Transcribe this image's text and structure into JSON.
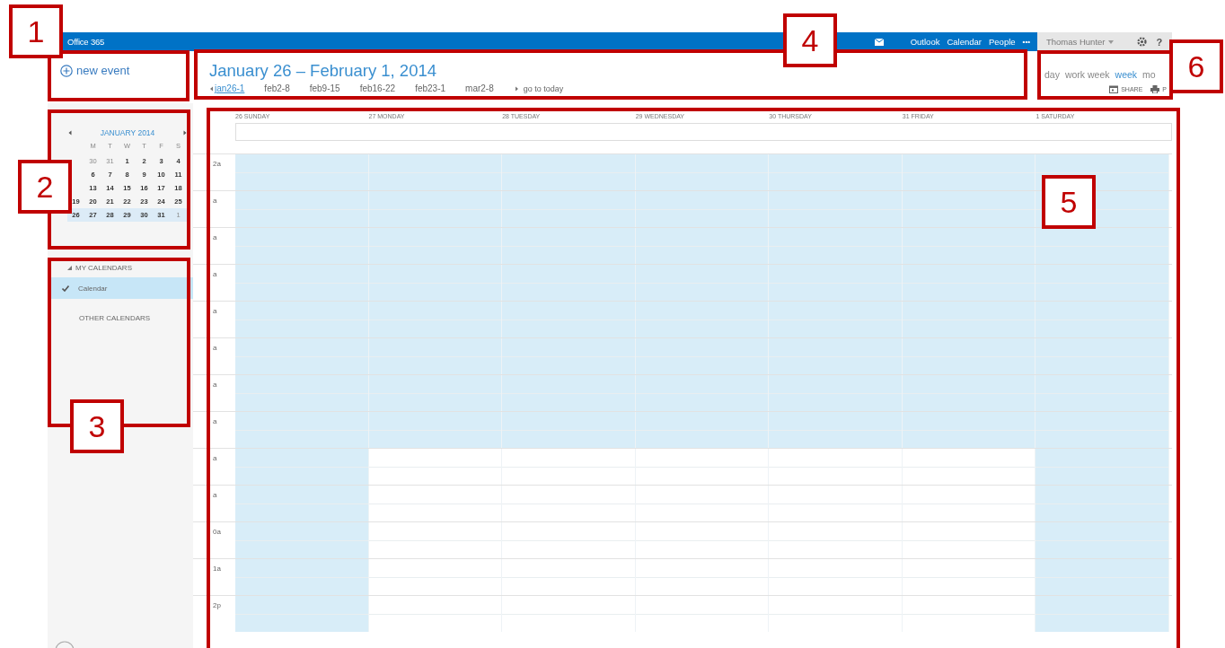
{
  "top_bar": {
    "product": "Office 365",
    "nav": [
      "Outlook",
      "Calendar",
      "People"
    ],
    "more": "•••",
    "user": "Thomas Hunter",
    "help": "?"
  },
  "new_event": {
    "label": "new event"
  },
  "header": {
    "title": "January 26 – February 1, 2014",
    "weeks": [
      {
        "label": "jan26-1",
        "selected": true
      },
      {
        "label": "feb2-8",
        "selected": false
      },
      {
        "label": "feb9-15",
        "selected": false
      },
      {
        "label": "feb16-22",
        "selected": false
      },
      {
        "label": "feb23-1",
        "selected": false
      },
      {
        "label": "mar2-8",
        "selected": false
      }
    ],
    "today": "go to today"
  },
  "views": [
    {
      "label": "day",
      "selected": false
    },
    {
      "label": "work week",
      "selected": false
    },
    {
      "label": "week",
      "selected": true
    },
    {
      "label": "mo",
      "selected": false
    }
  ],
  "actions": [
    {
      "kind": "share",
      "label": "SHARE"
    },
    {
      "kind": "print",
      "label": "P"
    }
  ],
  "mini_calendar": {
    "title": "JANUARY 2014",
    "weekdays": [
      "M",
      "T",
      "W",
      "T",
      "F",
      "S"
    ],
    "weeks": [
      {
        "selected": false,
        "days": [
          {
            "d": "30",
            "other": true
          },
          {
            "d": "31",
            "other": true
          },
          {
            "d": "1",
            "other": false
          },
          {
            "d": "2",
            "other": false
          },
          {
            "d": "3",
            "other": false
          },
          {
            "d": "4",
            "other": false
          }
        ]
      },
      {
        "selected": false,
        "days": [
          {
            "d": "6",
            "other": false
          },
          {
            "d": "7",
            "other": false
          },
          {
            "d": "8",
            "other": false
          },
          {
            "d": "9",
            "other": false
          },
          {
            "d": "10",
            "other": false
          },
          {
            "d": "11",
            "other": false
          }
        ]
      },
      {
        "selected": false,
        "days": [
          {
            "d": "13",
            "other": false
          },
          {
            "d": "14",
            "other": false
          },
          {
            "d": "15",
            "other": false
          },
          {
            "d": "16",
            "other": false
          },
          {
            "d": "17",
            "other": false
          },
          {
            "d": "18",
            "other": false
          }
        ]
      },
      {
        "selected": false,
        "days": [
          {
            "d": "19",
            "other": false
          },
          {
            "d": "20",
            "other": false
          },
          {
            "d": "21",
            "other": false
          },
          {
            "d": "22",
            "other": false
          },
          {
            "d": "23",
            "other": false
          },
          {
            "d": "24",
            "other": false
          },
          {
            "d": "25",
            "other": false
          }
        ]
      },
      {
        "selected": true,
        "days": [
          {
            "d": "26",
            "other": false
          },
          {
            "d": "27",
            "other": false
          },
          {
            "d": "28",
            "other": false
          },
          {
            "d": "29",
            "other": false
          },
          {
            "d": "30",
            "other": false
          },
          {
            "d": "31",
            "other": false
          },
          {
            "d": "1",
            "other": true
          }
        ]
      }
    ]
  },
  "calendars": {
    "my_heading": "MY CALENDARS",
    "items": [
      {
        "label": "Calendar",
        "selected": true,
        "checked": true
      }
    ],
    "other_heading": "OTHER CALENDARS"
  },
  "week_view": {
    "days": [
      {
        "label": "26 SUNDAY"
      },
      {
        "label": "27 MONDAY"
      },
      {
        "label": "28 TUESDAY"
      },
      {
        "label": "29 WEDNESDAY"
      },
      {
        "label": "30 THURSDAY"
      },
      {
        "label": "31 FRIDAY"
      },
      {
        "label": "1 SATURDAY"
      }
    ],
    "hours": [
      {
        "label": "2a",
        "shaded": [
          true,
          true,
          true,
          true,
          true,
          true,
          true
        ]
      },
      {
        "label": "a",
        "shaded": [
          true,
          true,
          true,
          true,
          true,
          true,
          true
        ]
      },
      {
        "label": "a",
        "shaded": [
          true,
          true,
          true,
          true,
          true,
          true,
          true
        ]
      },
      {
        "label": "a",
        "shaded": [
          true,
          true,
          true,
          true,
          true,
          true,
          true
        ]
      },
      {
        "label": "a",
        "shaded": [
          true,
          true,
          true,
          true,
          true,
          true,
          true
        ]
      },
      {
        "label": "a",
        "shaded": [
          true,
          true,
          true,
          true,
          true,
          true,
          true
        ]
      },
      {
        "label": "a",
        "shaded": [
          true,
          true,
          true,
          true,
          true,
          true,
          true
        ]
      },
      {
        "label": "a",
        "shaded": [
          true,
          true,
          true,
          true,
          true,
          true,
          true
        ]
      },
      {
        "label": "a",
        "shaded": [
          true,
          false,
          false,
          false,
          false,
          false,
          true
        ]
      },
      {
        "label": "a",
        "shaded": [
          true,
          false,
          false,
          false,
          false,
          false,
          true
        ]
      },
      {
        "label": "0a",
        "shaded": [
          true,
          false,
          false,
          false,
          false,
          false,
          true
        ]
      },
      {
        "label": "1a",
        "shaded": [
          true,
          false,
          false,
          false,
          false,
          false,
          true
        ]
      },
      {
        "label": "2p",
        "shaded": [
          true,
          false,
          false,
          false,
          false,
          false,
          true
        ]
      }
    ]
  },
  "annotations": [
    {
      "number": "1"
    },
    {
      "number": "2"
    },
    {
      "number": "3"
    },
    {
      "number": "4"
    },
    {
      "number": "5"
    },
    {
      "number": "6"
    }
  ]
}
